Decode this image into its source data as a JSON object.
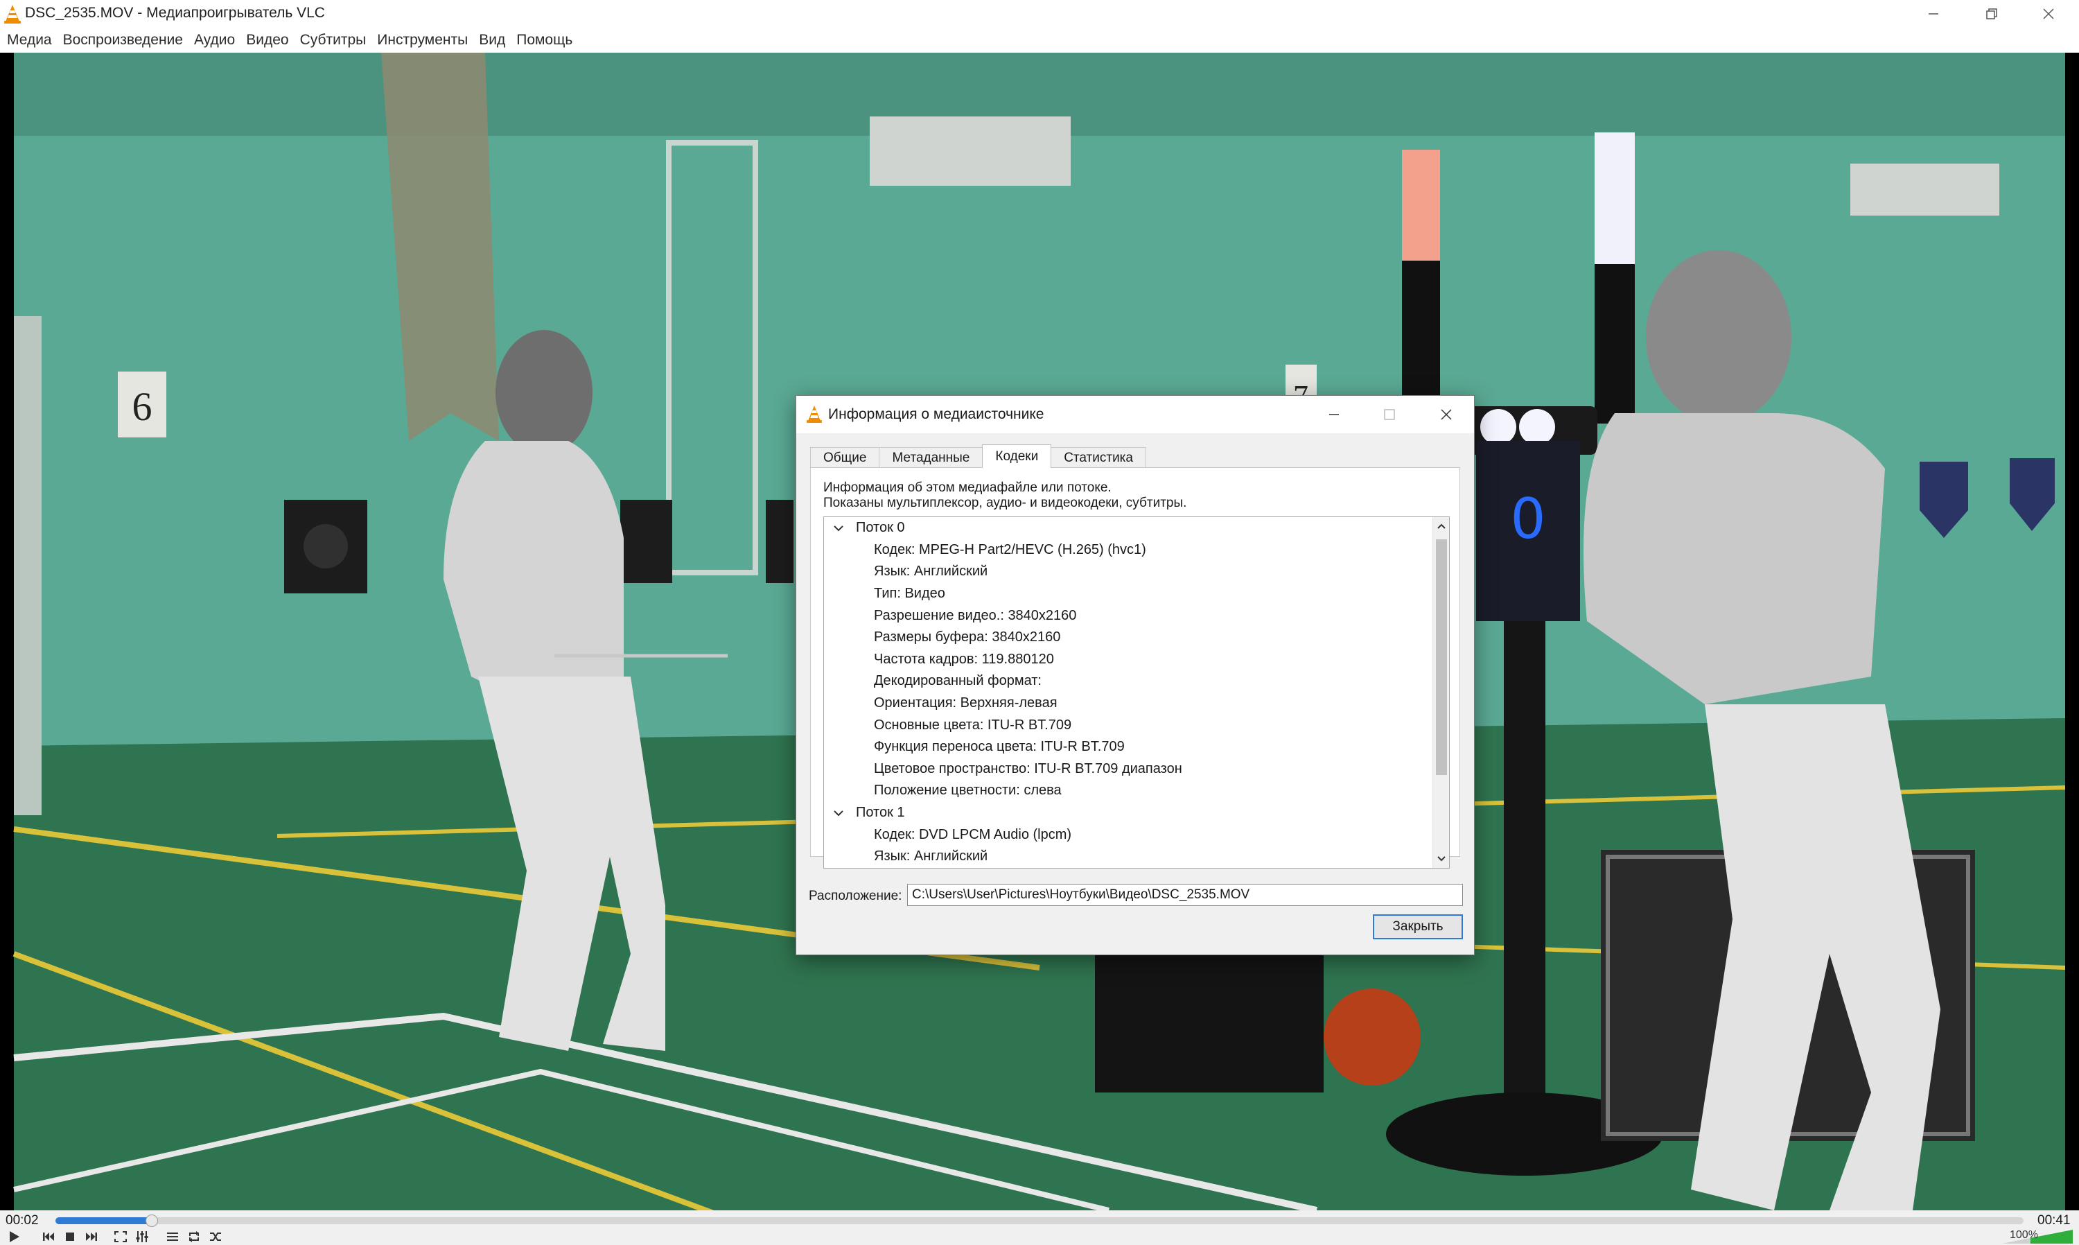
{
  "window": {
    "title": "DSC_2535.MOV - Медиапроигрыватель VLC",
    "icon": "vlc-cone-icon",
    "controls": [
      "minimize-icon",
      "restore-icon",
      "close-icon"
    ]
  },
  "menu": {
    "items": [
      {
        "label": "Медиа"
      },
      {
        "label": "Воспроизведение"
      },
      {
        "label": "Аудио"
      },
      {
        "label": "Видео"
      },
      {
        "label": "Субтитры"
      },
      {
        "label": "Инструменты"
      },
      {
        "label": "Вид"
      },
      {
        "label": "Помощь"
      }
    ]
  },
  "video": {
    "banner_number_left": "6",
    "banner_number_right": "7",
    "score_display": "0"
  },
  "player": {
    "time_elapsed": "00:02",
    "time_total": "00:41",
    "progress_fraction": 0.049,
    "volume_label": "100%",
    "buttons": [
      "play-icon",
      "prev-icon",
      "stop-icon",
      "next-icon",
      "fullscreen-icon",
      "extended-settings-icon",
      "playlist-icon",
      "loop-icon",
      "shuffle-icon"
    ]
  },
  "dialog": {
    "title": "Информация о медиаисточнике",
    "tabs": [
      {
        "label": "Общие",
        "active": false
      },
      {
        "label": "Метаданные",
        "active": false
      },
      {
        "label": "Кодеки",
        "active": true
      },
      {
        "label": "Статистика",
        "active": false
      }
    ],
    "description_line1": "Информация об этом медиафайле или потоке.",
    "description_line2": "Показаны мультиплексор, аудио- и видеокодеки, субтитры.",
    "tree": [
      {
        "kind": "stream",
        "label": "Поток 0"
      },
      {
        "kind": "prop",
        "label": "Кодек: MPEG-H Part2/HEVC (H.265) (hvc1)"
      },
      {
        "kind": "prop",
        "label": "Язык: Английский"
      },
      {
        "kind": "prop",
        "label": "Тип: Видео"
      },
      {
        "kind": "prop",
        "label": "Разрешение видео.: 3840x2160"
      },
      {
        "kind": "prop",
        "label": "Размеры буфера: 3840x2160"
      },
      {
        "kind": "prop",
        "label": "Частота кадров: 119.880120"
      },
      {
        "kind": "prop",
        "label": "Декодированный формат:"
      },
      {
        "kind": "prop",
        "label": "Ориентация: Верхняя-левая"
      },
      {
        "kind": "prop",
        "label": "Основные цвета: ITU-R BT.709"
      },
      {
        "kind": "prop",
        "label": "Функция переноса цвета: ITU-R BT.709"
      },
      {
        "kind": "prop",
        "label": "Цветовое пространство: ITU-R BT.709 диапазон"
      },
      {
        "kind": "prop",
        "label": "Положение цветности: слева"
      },
      {
        "kind": "stream",
        "label": "Поток 1"
      },
      {
        "kind": "prop",
        "label": "Кодек: DVD LPCM Audio (lpcm)"
      },
      {
        "kind": "prop",
        "label": "Язык: Английский"
      }
    ],
    "location_label": "Расположение:",
    "location_value": "C:\\Users\\User\\Pictures\\Ноутбуки\\Видео\\DSC_2535.MOV",
    "close_button": "Закрыть"
  },
  "colors": {
    "vlc_orange": "#f08c00",
    "seek_fill": "#2e7bd6",
    "button_focus": "#2f7ad6",
    "court_green": "#2f7450",
    "wall_mint": "#58a893"
  }
}
